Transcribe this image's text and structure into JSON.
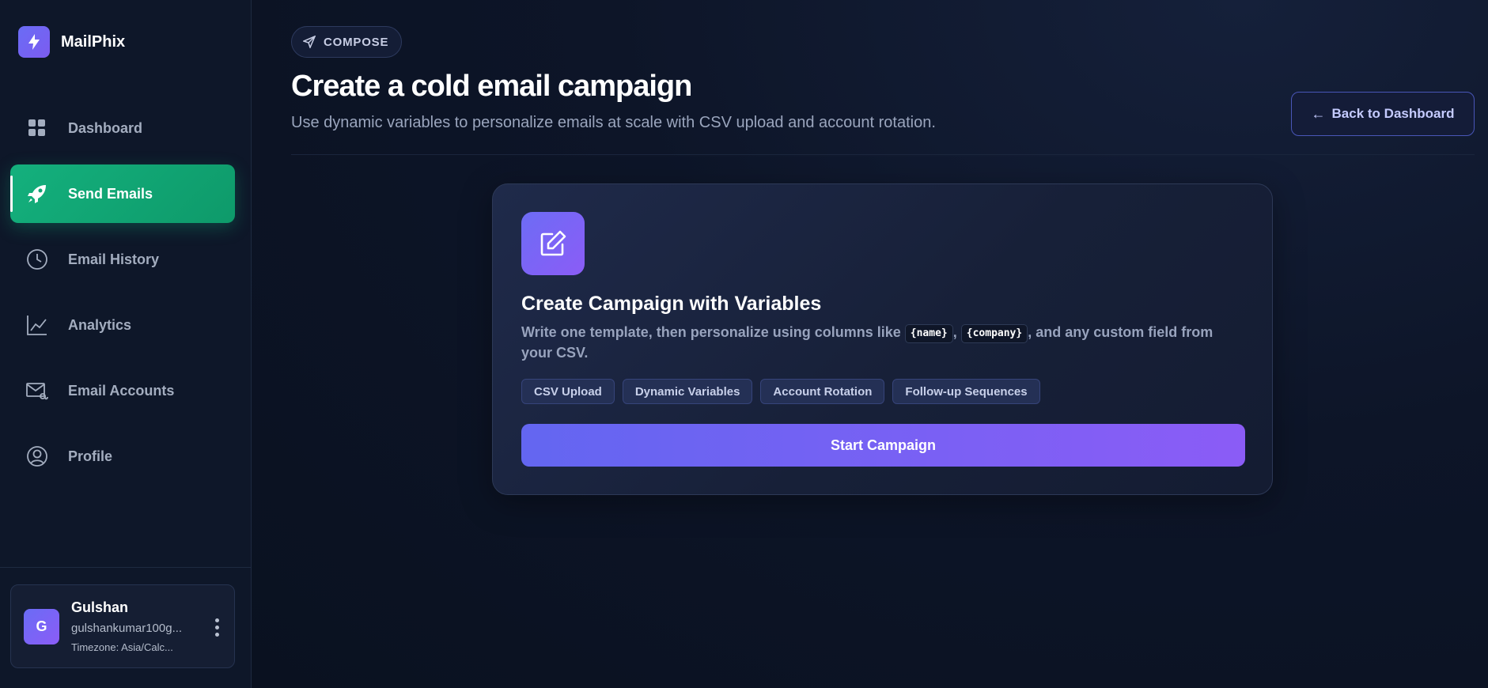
{
  "brand": {
    "name": "MailPhix",
    "icon": "lightning-bolt-icon"
  },
  "sidebar": {
    "items": [
      {
        "label": "Dashboard",
        "icon": "grid-icon",
        "active": false
      },
      {
        "label": "Send Emails",
        "icon": "rocket-icon",
        "active": true
      },
      {
        "label": "Email History",
        "icon": "clock-icon",
        "active": false
      },
      {
        "label": "Analytics",
        "icon": "line-chart-icon",
        "active": false
      },
      {
        "label": "Email Accounts",
        "icon": "mail-at-icon",
        "active": false
      },
      {
        "label": "Profile",
        "icon": "user-circle-icon",
        "active": false
      }
    ]
  },
  "user": {
    "initial": "G",
    "name": "Gulshan",
    "email": "gulshankumar100g...",
    "timezone": "Timezone: Asia/Calc..."
  },
  "header": {
    "badge": "COMPOSE",
    "title": "Create a cold email campaign",
    "subtitle": "Use dynamic variables to personalize emails at scale with CSV upload and account rotation.",
    "back_button": "Back to Dashboard"
  },
  "card": {
    "title": "Create Campaign with Variables",
    "desc_prefix": "Write one template, then personalize using columns like ",
    "var_name": "{name}",
    "desc_sep": ", ",
    "var_company": "{company}",
    "desc_suffix": ", and any custom field from your CSV.",
    "tags": [
      "CSV Upload",
      "Dynamic Variables",
      "Account Rotation",
      "Follow-up Sequences"
    ],
    "cta": "Start Campaign"
  },
  "colors": {
    "accent": "#6366f1",
    "active_nav": "#10b981",
    "background": "#0b1222"
  }
}
